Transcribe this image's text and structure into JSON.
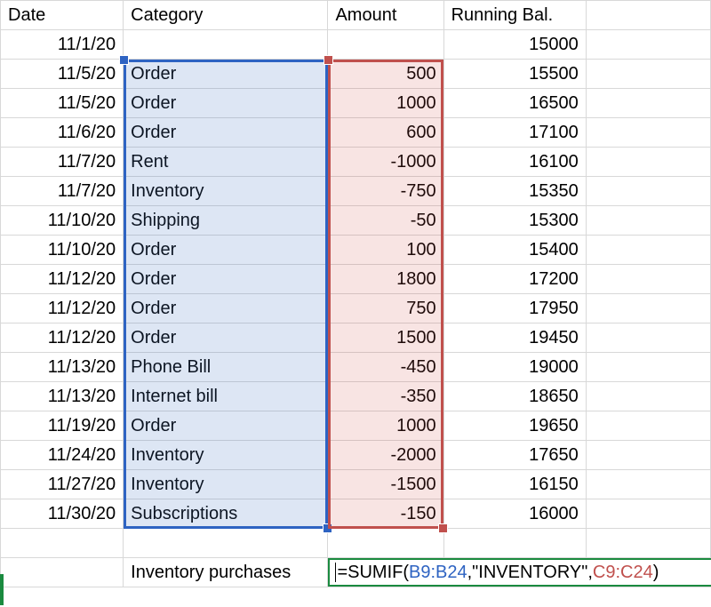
{
  "columns": {
    "date": "Date",
    "category": "Category",
    "amount": "Amount",
    "running": "Running Bal."
  },
  "opening": {
    "date": "11/1/20",
    "category": "",
    "amount": "",
    "running": "15000"
  },
  "rows": [
    {
      "date": "11/5/20",
      "category": "Order",
      "amount": "500",
      "running": "15500"
    },
    {
      "date": "11/5/20",
      "category": "Order",
      "amount": "1000",
      "running": "16500"
    },
    {
      "date": "11/6/20",
      "category": "Order",
      "amount": "600",
      "running": "17100"
    },
    {
      "date": "11/7/20",
      "category": "Rent",
      "amount": "-1000",
      "running": "16100"
    },
    {
      "date": "11/7/20",
      "category": "Inventory",
      "amount": "-750",
      "running": "15350"
    },
    {
      "date": "11/10/20",
      "category": "Shipping",
      "amount": "-50",
      "running": "15300"
    },
    {
      "date": "11/10/20",
      "category": "Order",
      "amount": "100",
      "running": "15400"
    },
    {
      "date": "11/12/20",
      "category": "Order",
      "amount": "1800",
      "running": "17200"
    },
    {
      "date": "11/12/20",
      "category": "Order",
      "amount": "750",
      "running": "17950"
    },
    {
      "date": "11/12/20",
      "category": "Order",
      "amount": "1500",
      "running": "19450"
    },
    {
      "date": "11/13/20",
      "category": "Phone Bill",
      "amount": "-450",
      "running": "19000"
    },
    {
      "date": "11/13/20",
      "category": "Internet bill",
      "amount": "-350",
      "running": "18650"
    },
    {
      "date": "11/19/20",
      "category": "Order",
      "amount": "1000",
      "running": "19650"
    },
    {
      "date": "11/24/20",
      "category": "Inventory",
      "amount": "-2000",
      "running": "17650"
    },
    {
      "date": "11/27/20",
      "category": "Inventory",
      "amount": "-1500",
      "running": "16150"
    },
    {
      "date": "11/30/20",
      "category": "Subscriptions",
      "amount": "-150",
      "running": "16000"
    }
  ],
  "formula_row": {
    "label": "Inventory purchases",
    "prefix": "=SUMIF(",
    "range1": "B9:B24",
    "sep1": ",\"INVENTORY\",",
    "range2": "C9:C24",
    "suffix": ")"
  },
  "selections": {
    "blue": {
      "ref": "B9:B24"
    },
    "red": {
      "ref": "C9:C24"
    }
  },
  "chart_data": {
    "type": "table",
    "title": "Ledger with running balance and SUMIF formula entry",
    "headers": [
      "Date",
      "Category",
      "Amount",
      "Running Bal."
    ],
    "rows": [
      [
        "11/1/20",
        "",
        "",
        15000
      ],
      [
        "11/5/20",
        "Order",
        500,
        15500
      ],
      [
        "11/5/20",
        "Order",
        1000,
        16500
      ],
      [
        "11/6/20",
        "Order",
        600,
        17100
      ],
      [
        "11/7/20",
        "Rent",
        -1000,
        16100
      ],
      [
        "11/7/20",
        "Inventory",
        -750,
        15350
      ],
      [
        "11/10/20",
        "Shipping",
        -50,
        15300
      ],
      [
        "11/10/20",
        "Order",
        100,
        15400
      ],
      [
        "11/12/20",
        "Order",
        1800,
        17200
      ],
      [
        "11/12/20",
        "Order",
        750,
        17950
      ],
      [
        "11/12/20",
        "Order",
        1500,
        19450
      ],
      [
        "11/13/20",
        "Phone Bill",
        -450,
        19000
      ],
      [
        "11/13/20",
        "Internet bill",
        -350,
        18650
      ],
      [
        "11/19/20",
        "Order",
        1000,
        19650
      ],
      [
        "11/24/20",
        "Inventory",
        -2000,
        17650
      ],
      [
        "11/27/20",
        "Inventory",
        -1500,
        16150
      ],
      [
        "11/30/20",
        "Subscriptions",
        -150,
        16000
      ]
    ],
    "formula": "=SUMIF(B9:B24,\"INVENTORY\",C9:C24)",
    "formula_label": "Inventory purchases"
  }
}
